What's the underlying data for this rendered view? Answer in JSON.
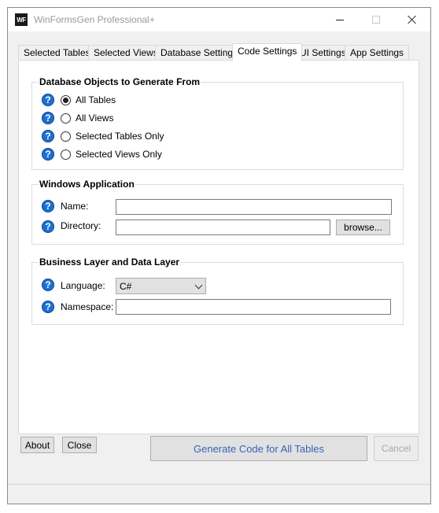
{
  "window": {
    "title": "WinFormsGen Professional+",
    "icon_text": "WF",
    "icon_name": "app-logo-icon"
  },
  "tabs": [
    {
      "label": "Selected Tables",
      "active": false
    },
    {
      "label": "Selected Views",
      "active": false
    },
    {
      "label": "Database Settings",
      "active": false
    },
    {
      "label": "Code Settings",
      "active": true
    },
    {
      "label": "UI Settings",
      "active": false
    },
    {
      "label": "App Settings",
      "active": false
    }
  ],
  "db_objects": {
    "title": "Database Objects to Generate From",
    "options": [
      {
        "label": "All Tables",
        "checked": true
      },
      {
        "label": "All Views",
        "checked": false
      },
      {
        "label": "Selected Tables Only",
        "checked": false
      },
      {
        "label": "Selected Views Only",
        "checked": false
      }
    ]
  },
  "windows_app": {
    "title": "Windows Application",
    "name_label": "Name:",
    "name_value": "",
    "directory_label": "Directory:",
    "directory_value": "",
    "browse_label": "browse..."
  },
  "business_layer": {
    "title": "Business Layer and Data Layer",
    "language_label": "Language:",
    "language_value": "C#",
    "namespace_label": "Namespace:",
    "namespace_value": ""
  },
  "footer": {
    "about_label": "About",
    "close_label": "Close",
    "generate_label": "Generate Code for All Tables",
    "cancel_label": "Cancel"
  },
  "help_icon_glyph": "?",
  "colors": {
    "help_icon": "#1e6fd0",
    "generate_text": "#3a63b7",
    "disabled_text": "#a8a8a8"
  }
}
